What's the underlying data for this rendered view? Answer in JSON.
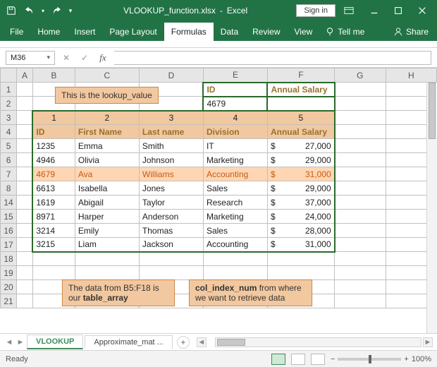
{
  "titlebar": {
    "filename": "VLOOKUP_function.xlsx",
    "app": "Excel",
    "signin": "Sign in"
  },
  "ribbon": {
    "tabs": [
      "File",
      "Home",
      "Insert",
      "Page Layout",
      "Formulas",
      "Data",
      "Review",
      "View"
    ],
    "active": "Formulas",
    "tellme": "Tell me",
    "share": "Share"
  },
  "formulabar": {
    "namebox": "M36",
    "formula": ""
  },
  "grid": {
    "col_letters": [
      "A",
      "B",
      "C",
      "D",
      "E",
      "F",
      "G",
      "H"
    ],
    "visible_rows": [
      "1",
      "2",
      "3",
      "4",
      "5",
      "6",
      "7",
      "8",
      "14",
      "15",
      "16",
      "17",
      "18",
      "19",
      "20",
      "21"
    ],
    "lookup_header": {
      "id": "ID",
      "salary": "Annual Salary"
    },
    "lookup_value": "4679",
    "index_row": [
      "1",
      "2",
      "3",
      "4",
      "5"
    ],
    "table_headers": [
      "ID",
      "First Name",
      "Last name",
      "Division",
      "Annual Salary"
    ],
    "rows": [
      {
        "n": "5",
        "id": "1235",
        "fn": "Emma",
        "ln": "Smith",
        "div": "IT",
        "sal": "27,000"
      },
      {
        "n": "6",
        "id": "4946",
        "fn": "Olivia",
        "ln": "Johnson",
        "div": "Marketing",
        "sal": "29,000"
      },
      {
        "n": "7",
        "id": "4679",
        "fn": "Ava",
        "ln": "Williams",
        "div": "Accounting",
        "sal": "31,000",
        "hl": true
      },
      {
        "n": "8",
        "id": "6613",
        "fn": "Isabella",
        "ln": "Jones",
        "div": "Sales",
        "sal": "29,000"
      },
      {
        "n": "14",
        "id": "1619",
        "fn": "Abigail",
        "ln": "Taylor",
        "div": "Research",
        "sal": "37,000"
      },
      {
        "n": "15",
        "id": "8971",
        "fn": "Harper",
        "ln": "Anderson",
        "div": "Marketing",
        "sal": "24,000"
      },
      {
        "n": "16",
        "id": "3214",
        "fn": "Emily",
        "ln": "Thomas",
        "div": "Sales",
        "sal": "28,000"
      },
      {
        "n": "17",
        "id": "3215",
        "fn": "Liam",
        "ln": "Jackson",
        "div": "Accounting",
        "sal": "31,000"
      }
    ]
  },
  "callouts": {
    "c1": "This is the lookup_value",
    "c2a": "The data from B5:F18 is",
    "c2b": "our ",
    "c2bold": "table_array",
    "c3a": "col_index_num",
    "c3b": " from where",
    "c3c": "we want to retrieve data"
  },
  "sheets": {
    "tabs": [
      "VLOOKUP",
      "Approximate_mat ..."
    ],
    "active": "VLOOKUP"
  },
  "statusbar": {
    "ready": "Ready",
    "zoom": "100%"
  }
}
